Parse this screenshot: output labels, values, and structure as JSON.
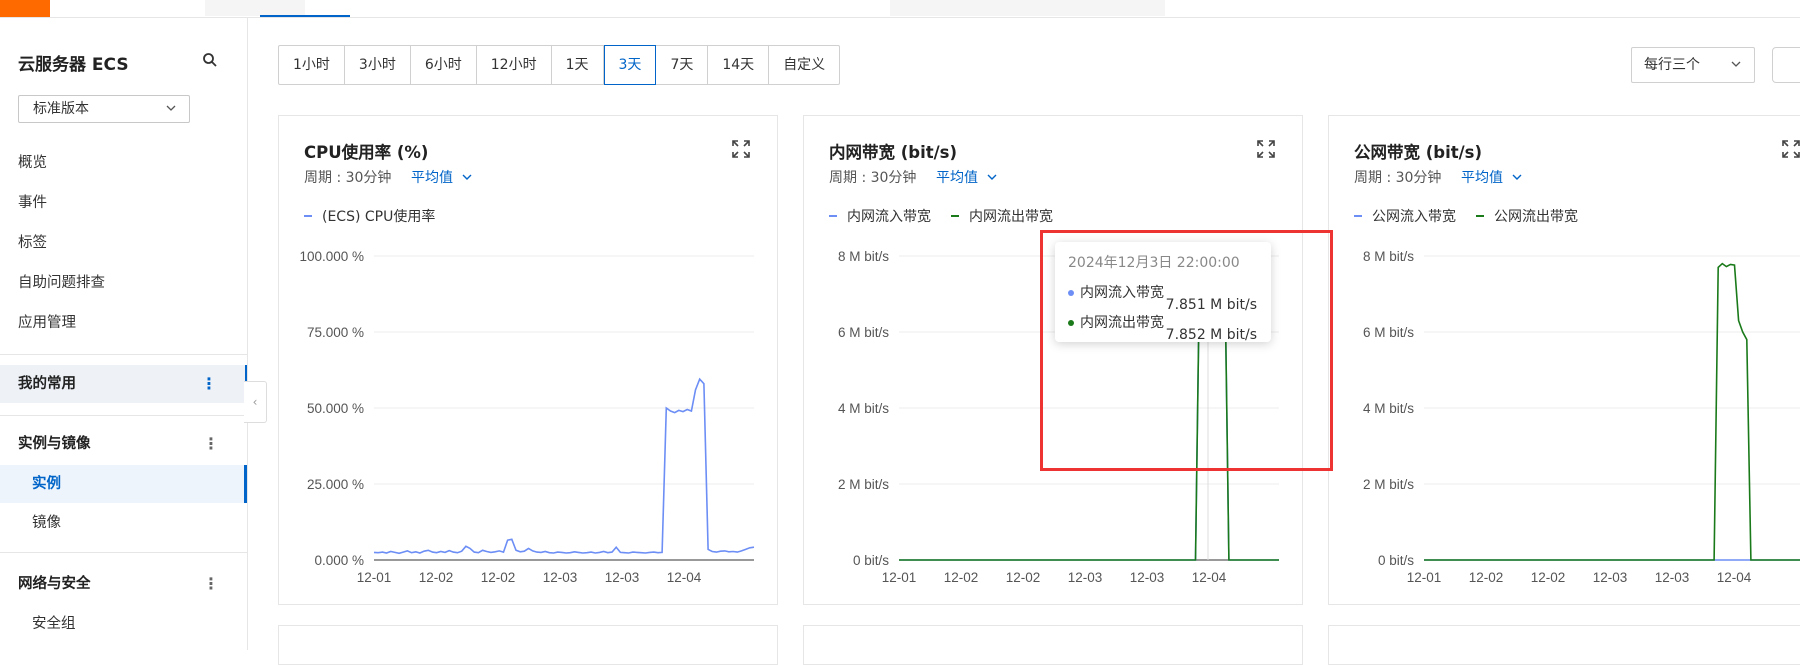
{
  "sidebar": {
    "title": "云服务器 ECS",
    "version": "标准版本",
    "items": [
      {
        "label": "概览"
      },
      {
        "label": "事件"
      },
      {
        "label": "标签"
      },
      {
        "label": "自助问题排查"
      },
      {
        "label": "应用管理"
      }
    ],
    "groups": [
      {
        "label": "我的常用"
      },
      {
        "label": "实例与镜像"
      },
      {
        "label": "网络与安全"
      }
    ],
    "sub_items": [
      {
        "label": "实例"
      },
      {
        "label": "镜像"
      },
      {
        "label": "安全组"
      }
    ]
  },
  "toolbar": {
    "ranges": [
      "1小时",
      "3小时",
      "6小时",
      "12小时",
      "1天",
      "3天",
      "7天",
      "14天",
      "自定义"
    ],
    "selected": "3天",
    "per_row": "每行三个"
  },
  "cards": [
    {
      "title": "CPU使用率 (%)",
      "period": "周期 : 30分钟",
      "agg": "平均值"
    },
    {
      "title": "内网带宽 (bit/s)",
      "period": "周期 : 30分钟",
      "agg": "平均值"
    },
    {
      "title": "公网带宽 (bit/s)",
      "period": "周期 : 30分钟",
      "agg": "平均值"
    }
  ],
  "tooltip": {
    "time": "2024年12月3日 22:00:00",
    "rows": [
      {
        "name": "内网流入带宽",
        "value": "7.851 M bit/s",
        "color": "#6c8ef5"
      },
      {
        "name": "内网流出带宽",
        "value": "7.852 M bit/s",
        "color": "#1a7a1a"
      }
    ]
  },
  "chart_data": [
    {
      "type": "line",
      "x_ticks": [
        "12-01",
        "12-02",
        "12-02",
        "12-03",
        "12-03",
        "12-04"
      ],
      "y_ticks": [
        "0.000 %",
        "25.000 %",
        "50.000 %",
        "75.000 %",
        "100.000 %"
      ],
      "ylim": [
        0,
        100
      ],
      "series": [
        {
          "name": "(ECS) CPU使用率",
          "color": "#6c8ef5",
          "values": [
            2.5,
            2.4,
            2.6,
            2.3,
            2.8,
            2.5,
            2.2,
            2.6,
            3.0,
            2.4,
            2.7,
            2.3,
            2.9,
            3.2,
            2.6,
            2.4,
            2.8,
            2.5,
            3.1,
            2.6,
            2.4,
            2.9,
            4.5,
            3.8,
            2.6,
            2.4,
            3.2,
            2.8,
            2.5,
            2.7,
            3.0,
            2.6,
            6.5,
            6.8,
            3.2,
            2.7,
            2.9,
            3.8,
            3.0,
            2.6,
            2.5,
            2.8,
            2.4,
            2.3,
            2.6,
            2.5,
            2.3,
            2.4,
            2.7,
            2.5,
            2.3,
            2.4,
            2.6,
            2.3,
            2.5,
            2.8,
            2.4,
            2.6,
            4.2,
            2.5,
            2.4,
            2.3,
            2.6,
            2.5,
            2.4,
            2.3,
            2.5,
            2.6,
            2.4,
            2.5,
            50.0,
            49.0,
            48.5,
            49.2,
            48.8,
            49.5,
            49.0,
            56.0,
            59.5,
            58.0,
            3.5,
            2.8,
            2.6,
            2.9,
            3.0,
            2.7,
            2.8,
            2.6,
            3.0,
            3.5,
            4.0,
            4.2
          ]
        }
      ]
    },
    {
      "type": "line",
      "x_ticks": [
        "12-01",
        "12-02",
        "12-02",
        "12-03",
        "12-03",
        "12-04"
      ],
      "y_ticks": [
        "0  bit/s",
        "2 M bit/s",
        "4 M bit/s",
        "6 M bit/s",
        "8 M bit/s"
      ],
      "ylim": [
        0,
        8
      ],
      "series": [
        {
          "name": "内网流入带宽",
          "color": "#6c8ef5",
          "values": [
            0,
            0,
            0,
            0,
            0,
            0,
            0,
            0,
            0,
            0,
            0,
            0,
            0,
            0,
            0,
            0,
            0,
            0,
            0,
            0,
            0,
            0,
            0,
            0,
            0,
            0,
            0,
            0,
            0,
            0,
            0,
            0,
            0,
            0,
            0,
            0,
            0,
            0,
            0,
            0,
            0,
            0,
            0,
            0,
            0,
            0,
            0,
            0,
            0,
            0,
            0,
            0,
            0,
            0,
            0,
            0,
            0,
            0,
            0,
            0,
            0,
            0,
            0,
            0,
            0,
            0,
            0,
            0,
            0,
            0,
            0,
            0,
            7.851,
            7.85,
            7.852,
            7.851,
            7.85,
            7.85,
            7.85,
            0,
            0,
            0,
            0,
            0,
            0,
            0,
            0,
            0,
            0,
            0,
            0,
            0
          ]
        },
        {
          "name": "内网流出带宽",
          "color": "#1a7a1a",
          "values": [
            0,
            0,
            0,
            0,
            0,
            0,
            0,
            0,
            0,
            0,
            0,
            0,
            0,
            0,
            0,
            0,
            0,
            0,
            0,
            0,
            0,
            0,
            0,
            0,
            0,
            0,
            0,
            0,
            0,
            0,
            0,
            0,
            0,
            0,
            0,
            0,
            0,
            0,
            0,
            0,
            0,
            0,
            0,
            0,
            0,
            0,
            0,
            0,
            0,
            0,
            0,
            0,
            0,
            0,
            0,
            0,
            0,
            0,
            0,
            0,
            0,
            0,
            0,
            0,
            0,
            0,
            0,
            0,
            0,
            0,
            0,
            0,
            7.852,
            7.85,
            7.852,
            7.851,
            7.85,
            7.85,
            7.85,
            0,
            0,
            0,
            0,
            0,
            0,
            0,
            0,
            0,
            0,
            0,
            0,
            0
          ]
        }
      ]
    },
    {
      "type": "line",
      "x_ticks": [
        "12-01",
        "12-02",
        "12-02",
        "12-03",
        "12-03",
        "12-04"
      ],
      "y_ticks": [
        "0  bit/s",
        "2 M bit/s",
        "4 M bit/s",
        "6 M bit/s",
        "8 M bit/s"
      ],
      "ylim": [
        0,
        8
      ],
      "series": [
        {
          "name": "公网流入带宽",
          "color": "#6c8ef5",
          "values": [
            0,
            0,
            0,
            0,
            0,
            0,
            0,
            0,
            0,
            0,
            0,
            0,
            0,
            0,
            0,
            0,
            0,
            0,
            0,
            0,
            0,
            0,
            0,
            0,
            0,
            0,
            0,
            0,
            0,
            0,
            0,
            0,
            0,
            0,
            0,
            0,
            0,
            0,
            0,
            0,
            0,
            0,
            0,
            0,
            0,
            0,
            0,
            0,
            0,
            0,
            0,
            0,
            0,
            0,
            0,
            0,
            0,
            0,
            0,
            0,
            0,
            0,
            0,
            0,
            0,
            0,
            0,
            0,
            0,
            0,
            0,
            0,
            0,
            0,
            0,
            0,
            0,
            0,
            0,
            0,
            0,
            0,
            0,
            0,
            0,
            0,
            0,
            0,
            0,
            0,
            0,
            0
          ]
        },
        {
          "name": "公网流出带宽",
          "color": "#1a7a1a",
          "values": [
            0,
            0,
            0,
            0,
            0,
            0,
            0,
            0,
            0,
            0,
            0,
            0,
            0,
            0,
            0,
            0,
            0,
            0,
            0,
            0,
            0,
            0,
            0,
            0,
            0,
            0,
            0,
            0,
            0,
            0,
            0,
            0,
            0,
            0,
            0,
            0,
            0,
            0,
            0,
            0,
            0,
            0,
            0,
            0,
            0,
            0,
            0,
            0,
            0,
            0,
            0,
            0,
            0,
            0,
            0,
            0,
            0,
            0,
            0,
            0,
            0,
            0,
            0,
            0,
            0,
            0,
            0,
            0,
            0,
            0,
            0,
            0,
            7.7,
            7.8,
            7.72,
            7.78,
            7.76,
            6.3,
            6.0,
            5.8,
            0,
            0,
            0,
            0,
            0,
            0,
            0,
            0,
            0,
            0,
            0,
            0,
            0,
            0
          ]
        }
      ]
    }
  ]
}
